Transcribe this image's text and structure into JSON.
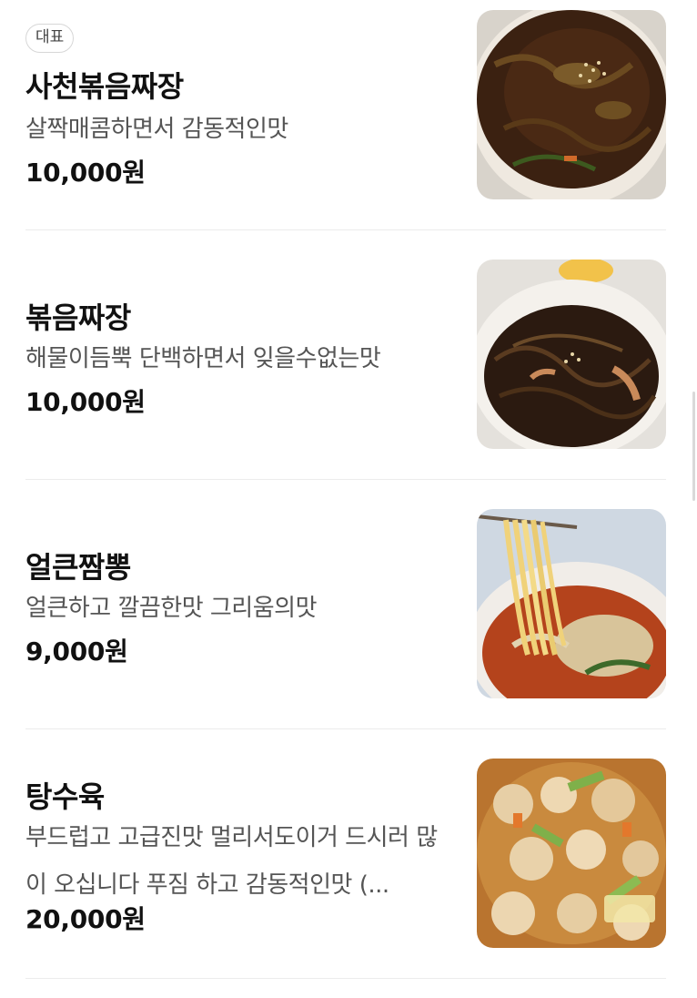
{
  "menu": {
    "items": [
      {
        "badge": "대표",
        "name": "사천볶음짜장",
        "description": "살짝매콤하면서 감동적인맛",
        "price": "10,000원",
        "image": "jjajang-noodle-photo"
      },
      {
        "name": "볶음짜장",
        "description": "해물이듬뿍 단백하면서 잊을수없는맛",
        "price": "10,000원",
        "image": "stir-fried-jjajang-photo"
      },
      {
        "name": "얼큰짬뽕",
        "description": "얼큰하고 깔끔한맛 그리움의맛",
        "price": "9,000원",
        "image": "jjamppong-photo"
      },
      {
        "name": "탕수육",
        "description": "부드럽고 고급진맛 멀리서도이거 드시러 많이 오십니다 푸짐 하고 감동적인맛 (...",
        "price": "20,000원",
        "image": "tangsuyuk-photo"
      }
    ]
  }
}
